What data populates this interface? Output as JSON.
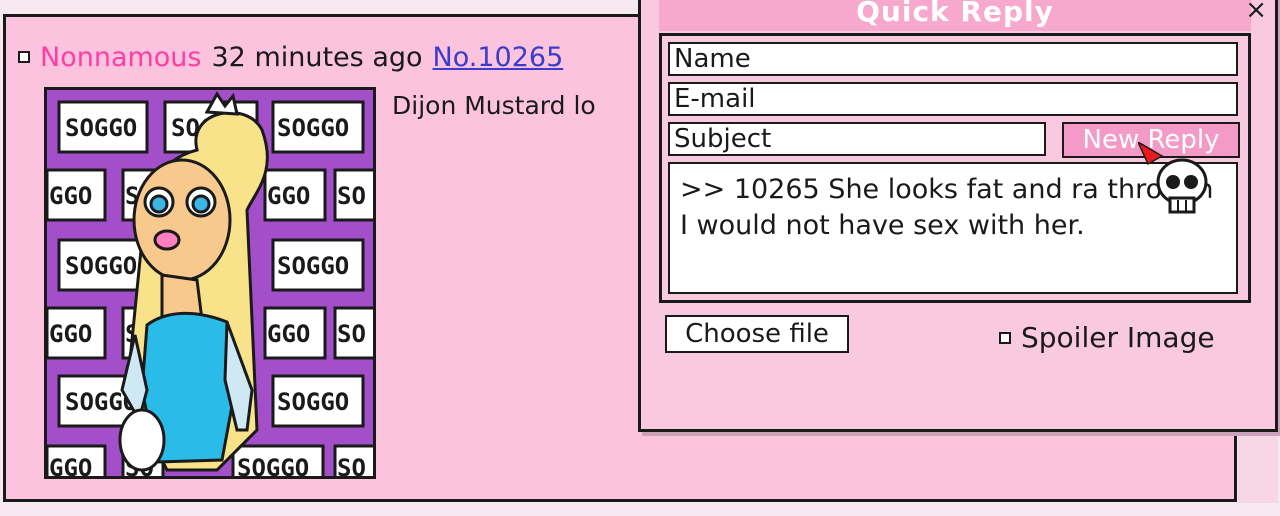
{
  "post": {
    "author": "Nonnamous",
    "time": "32 minutes ago",
    "number": "No.10265",
    "text_preview": "Dijon Mustard lo",
    "thumb_labels": [
      "SOGGO",
      "SOGGO",
      "SOGGO",
      "GGO",
      "SO",
      "GGO",
      "SO",
      "SOGGO",
      "SOGGO",
      "GGO",
      "SO",
      "GGO",
      "SO",
      "SOGGO",
      "SOGGO",
      "GGO",
      "SO",
      "SOGGO",
      "SO"
    ]
  },
  "quick_reply": {
    "title": "Quick Reply",
    "close": "×",
    "name_placeholder": "Name",
    "email_placeholder": "E-mail",
    "subject_placeholder": "Subject",
    "submit_label": "New Reply",
    "comment": ">> 10265 She looks fat and ra through I would not have sex with her.",
    "choose_file_label": "Choose file",
    "spoiler_label": "Spoiler Image"
  },
  "colors": {
    "accent": "#ff3ea5",
    "panel": "#fbc3dd",
    "link": "#3c3cc8"
  }
}
